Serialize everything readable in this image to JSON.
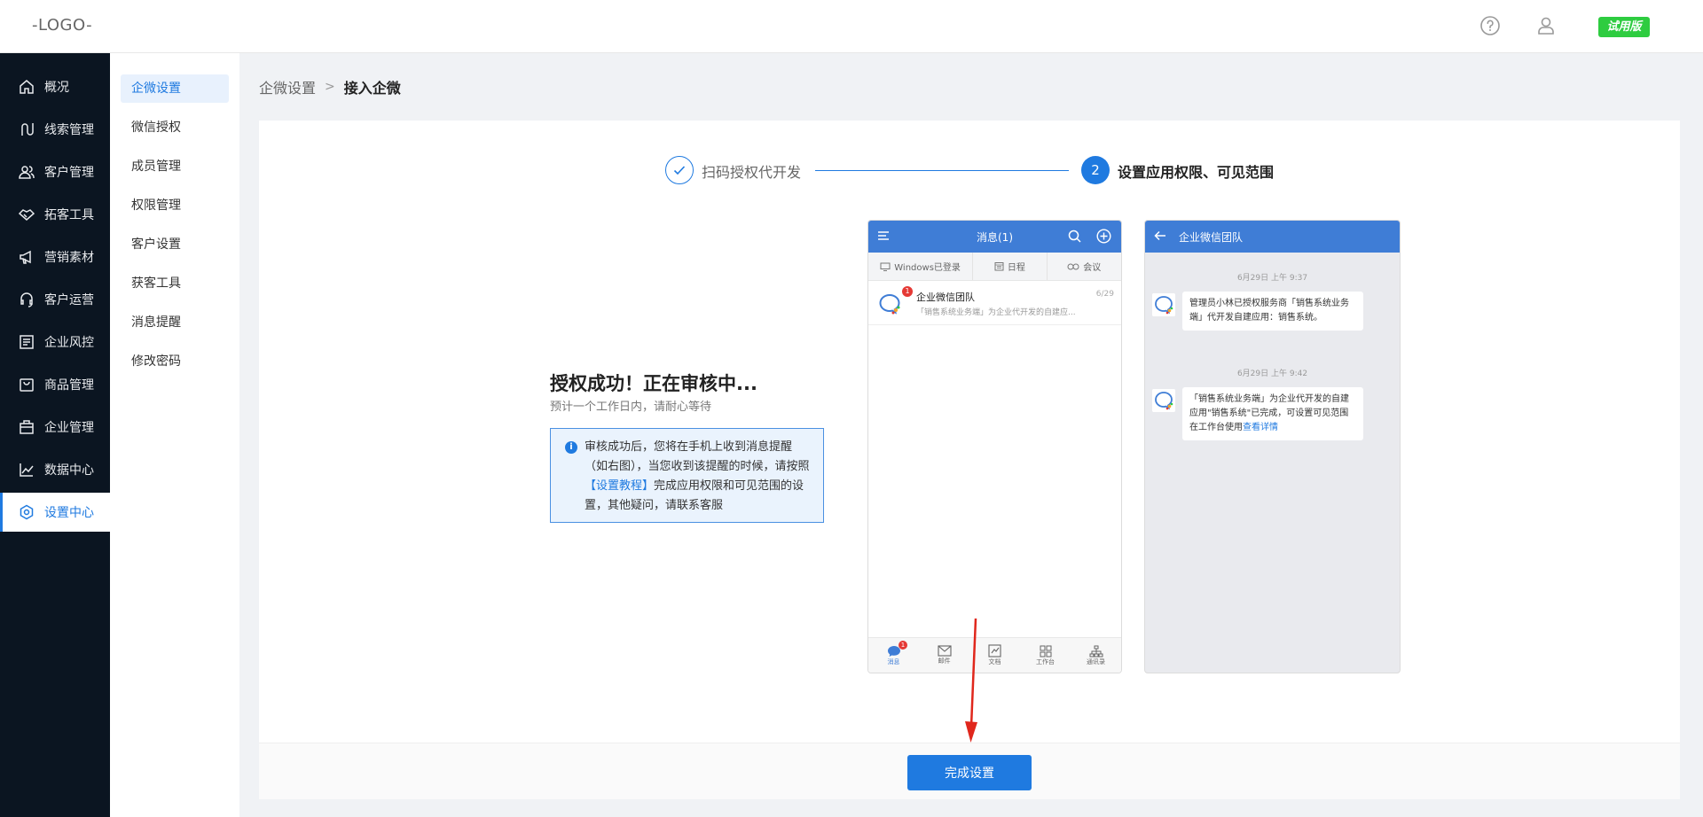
{
  "header": {
    "logo": "-LOGO-",
    "trial_badge": "试用版"
  },
  "sidebar": {
    "items": [
      {
        "label": "概况",
        "icon": "home-icon"
      },
      {
        "label": "线索管理",
        "icon": "route-icon"
      },
      {
        "label": "客户管理",
        "icon": "users-icon"
      },
      {
        "label": "拓客工具",
        "icon": "handshake-icon"
      },
      {
        "label": "营销素材",
        "icon": "megaphone-icon"
      },
      {
        "label": "客户运营",
        "icon": "support-icon"
      },
      {
        "label": "企业风控",
        "icon": "document-icon"
      },
      {
        "label": "商品管理",
        "icon": "bag-icon"
      },
      {
        "label": "企业管理",
        "icon": "briefcase-icon"
      },
      {
        "label": "数据中心",
        "icon": "chart-icon"
      },
      {
        "label": "设置中心",
        "icon": "settings-icon",
        "active": true
      }
    ]
  },
  "subnav": {
    "items": [
      "企微设置",
      "微信授权",
      "成员管理",
      "权限管理",
      "客户设置",
      "获客工具",
      "消息提醒",
      "修改密码"
    ]
  },
  "breadcrumb": {
    "parent": "企微设置",
    "separator": ">",
    "current": "接入企微"
  },
  "steps": {
    "step1": "扫码授权代开发",
    "step2_number": "2",
    "step2": "设置应用权限、可见范围"
  },
  "auth": {
    "title": "授权成功！正在审核中...",
    "subtitle": "预计一个工作日内，请耐心等待",
    "info_before": "审核成功后，您将在手机上收到消息提醒（如右图），当您收到该提醒的时候，请按照",
    "info_link": "【设置教程】",
    "info_after": "完成应用权限和可见范围的设置，其他疑问，请联系客服"
  },
  "phone1": {
    "title": "消息(1)",
    "tabs": [
      "Windows已登录",
      "日程",
      "会议"
    ],
    "message": {
      "name": "企业微信团队",
      "date": "6/29",
      "preview": "「销售系统业务端」为企业代开发的自建应...",
      "badge": "1"
    },
    "bottom_tabs": [
      "消息",
      "邮件",
      "文档",
      "工作台",
      "通讯录"
    ],
    "bottom_badge": "1"
  },
  "phone2": {
    "title": "企业微信团队",
    "messages": [
      {
        "time": "6月29日  上午 9:37",
        "text": "管理员小林已授权服务商「销售系统业务端」代开发自建应用：销售系统。"
      },
      {
        "time": "6月29日  上午 9:42",
        "text": "「销售系统业务端」为企业代开发的自建应用\"销售系统\"已完成，可设置可见范围在工作台使用",
        "link": "查看详情"
      }
    ]
  },
  "footer": {
    "finish_button": "完成设置"
  },
  "colors": {
    "accent": "#1f7ae0",
    "sidebar_bg": "#0b1521",
    "trial_badge": "#2ecc40",
    "arrow": "#e0271c"
  }
}
